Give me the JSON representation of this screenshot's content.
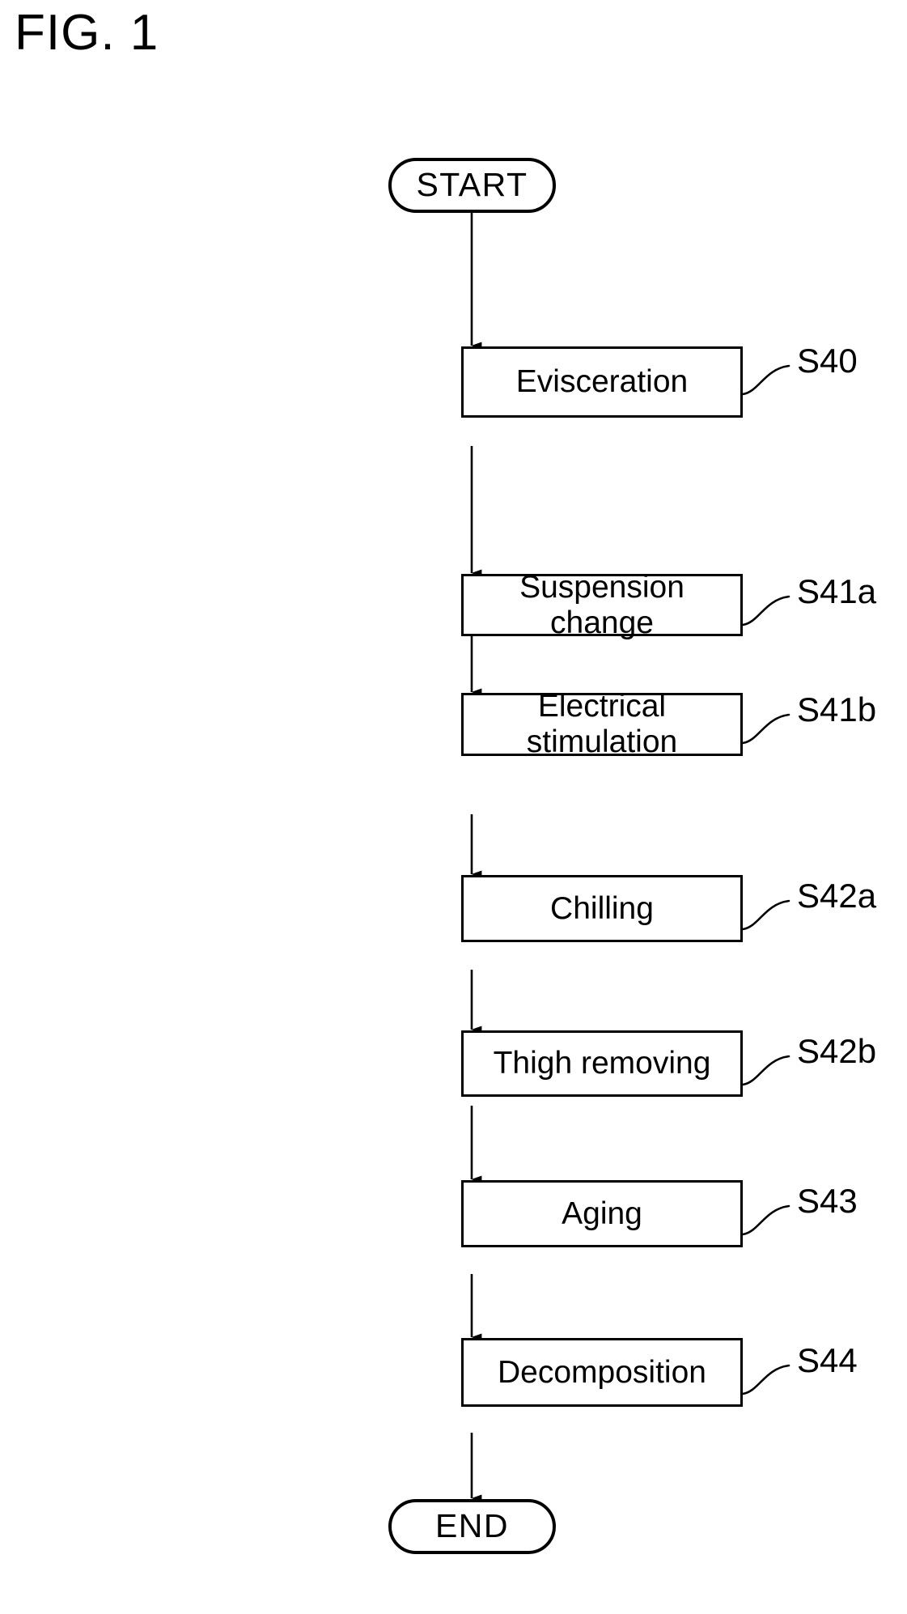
{
  "figure": {
    "title": "FIG. 1",
    "type": "flowchart",
    "orientation": "vertical"
  },
  "colors": {
    "stroke": "#000000",
    "fill": "#ffffff",
    "text": "#000000"
  },
  "nodes": [
    {
      "id": "start",
      "shape": "terminator",
      "label": "START",
      "ref": ""
    },
    {
      "id": "s40",
      "shape": "process",
      "label": "Evisceration",
      "ref": "S40"
    },
    {
      "id": "s41a",
      "shape": "process",
      "label": "Suspension\nchange",
      "ref": "S41a"
    },
    {
      "id": "s41b",
      "shape": "process",
      "label": "Electrical\nstimulation",
      "ref": "S41b"
    },
    {
      "id": "s42a",
      "shape": "process",
      "label": "Chilling",
      "ref": "S42a"
    },
    {
      "id": "s42b",
      "shape": "process",
      "label": "Thigh removing",
      "ref": "S42b"
    },
    {
      "id": "s43",
      "shape": "process",
      "label": "Aging",
      "ref": "S43"
    },
    {
      "id": "s44",
      "shape": "process",
      "label": "Decomposition",
      "ref": "S44"
    },
    {
      "id": "end",
      "shape": "terminator",
      "label": "END",
      "ref": ""
    }
  ],
  "edges": [
    {
      "from": "start",
      "to": "s40"
    },
    {
      "from": "s40",
      "to": "s41a"
    },
    {
      "from": "s41a",
      "to": "s41b"
    },
    {
      "from": "s41b",
      "to": "s42a"
    },
    {
      "from": "s42a",
      "to": "s42b"
    },
    {
      "from": "s42b",
      "to": "s43"
    },
    {
      "from": "s43",
      "to": "s44"
    },
    {
      "from": "s44",
      "to": "end"
    }
  ]
}
